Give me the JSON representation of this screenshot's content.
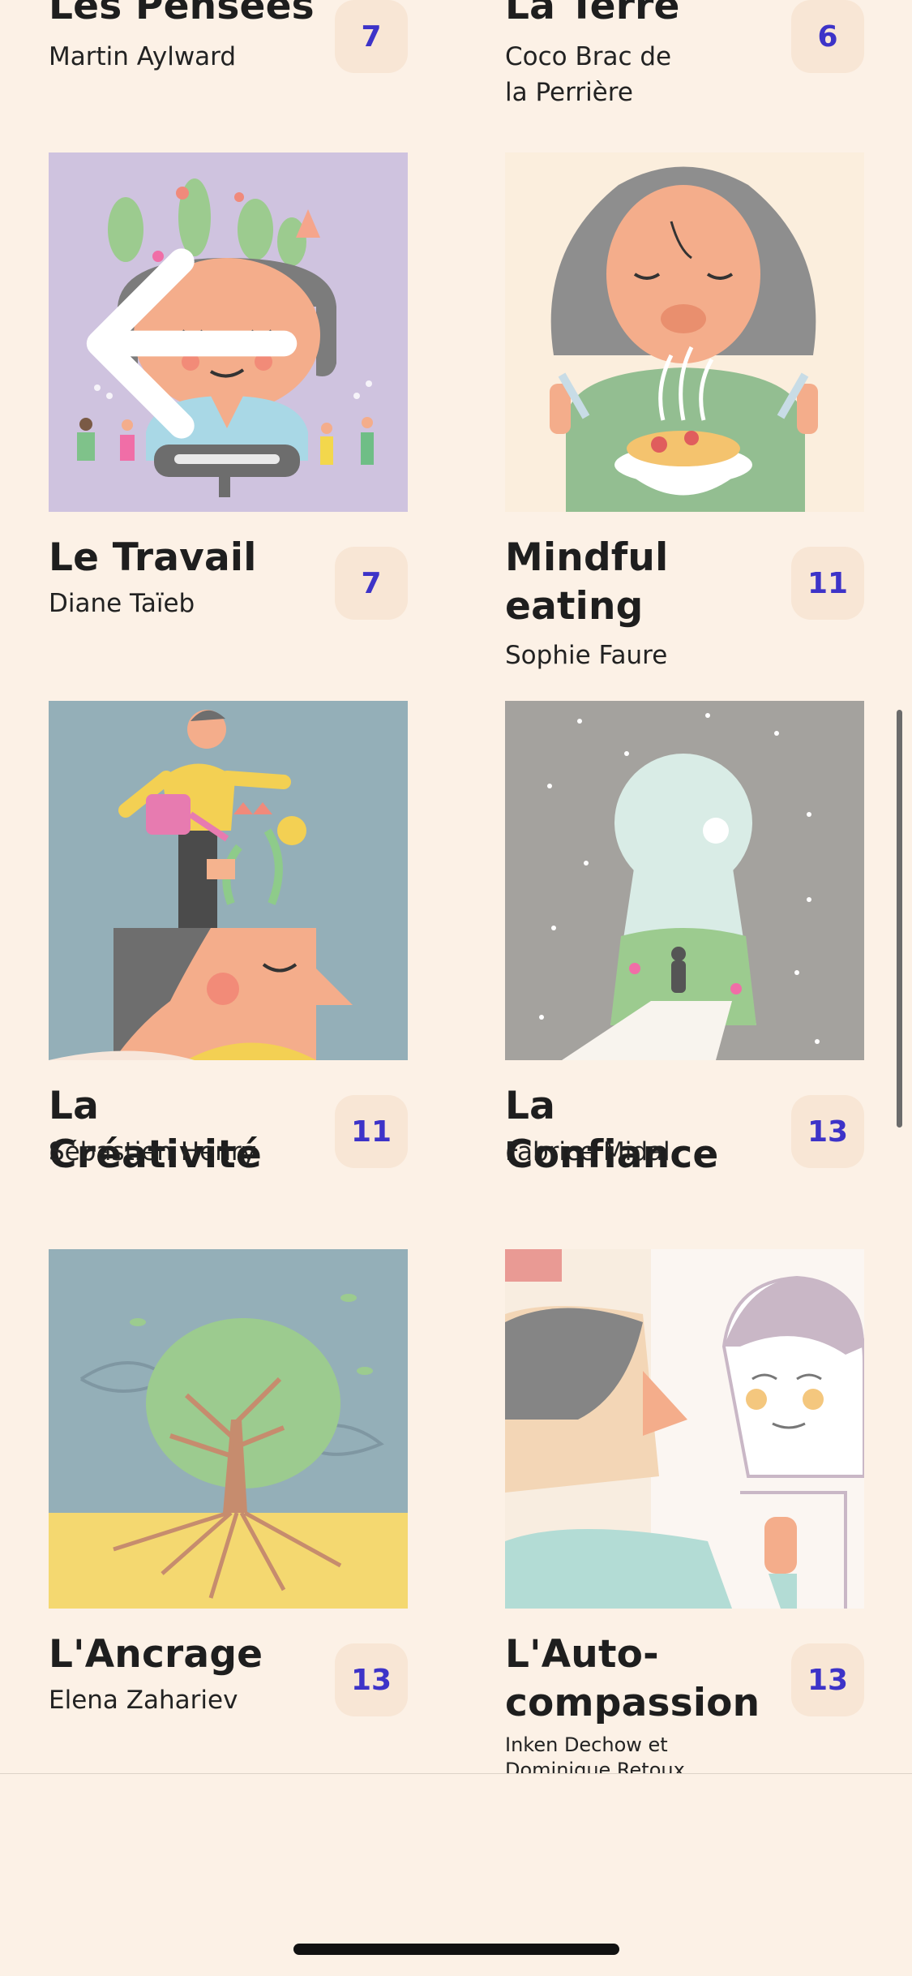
{
  "courses": [
    {
      "title": "Les Pensées",
      "author": "Martin Aylward",
      "count": "7",
      "illustration": "thoughts"
    },
    {
      "title": "La Terre",
      "author": "Coco Brac de\nla Perrière",
      "count": "6",
      "illustration": "earth"
    },
    {
      "title": "Le Travail",
      "author": "Diane Taïeb",
      "count": "7",
      "illustration": "work-head-garden"
    },
    {
      "title": "Mindful\neating",
      "author": "Sophie Faure",
      "count": "11",
      "illustration": "eating-bowl"
    },
    {
      "title": "La Créativité",
      "author": "Sébastien Henry",
      "count": "11",
      "illustration": "watering-head"
    },
    {
      "title": "La Confiance",
      "author": "Fabrice Midal",
      "count": "13",
      "illustration": "keyhole-night"
    },
    {
      "title": "L'Ancrage",
      "author": "Elena Zahariev",
      "count": "13",
      "illustration": "tree-roots"
    },
    {
      "title": "L'Auto-\ncompassion",
      "author": "Inken Dechow et\nDominique Retoux",
      "count": "13",
      "illustration": "mirror-faces"
    }
  ],
  "icons": {
    "back": "arrow-left-icon"
  },
  "colors": {
    "background": "#FCF1E6",
    "count_badge_bg": "#F8E6D5",
    "count_text": "#3D33C8",
    "title_text": "#1E1E1E"
  }
}
